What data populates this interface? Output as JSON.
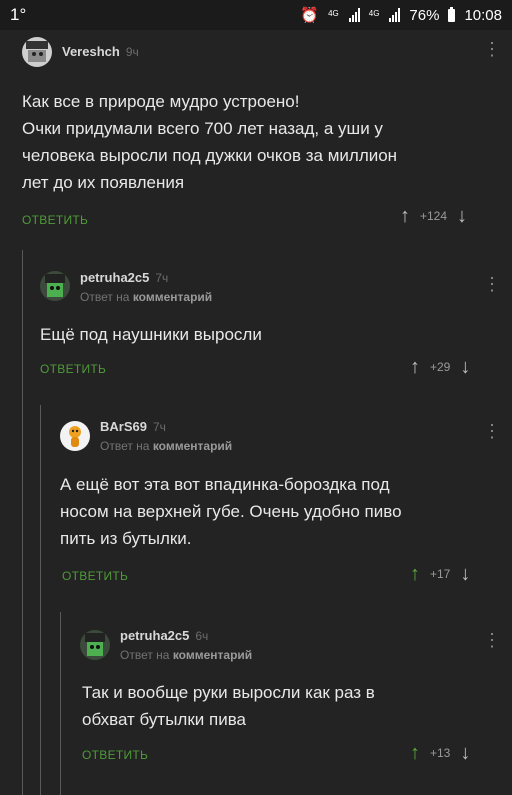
{
  "status": {
    "left": "1°",
    "net1": "4G",
    "net2": "4G",
    "battery_pct": "76%",
    "time": "10:08"
  },
  "comments": [
    {
      "author": "Vereshch",
      "time": "9ч",
      "body": [
        "Как все в природе мудро устроено!",
        "Очки придумали всего 700 лет назад, а уши у",
        "человека выросли под дужки очков за миллион",
        "лет до их появления"
      ],
      "reply": "ОТВЕТИТЬ",
      "score": "+124"
    },
    {
      "author": "petruha2c5",
      "time": "7ч",
      "sub_prefix": "Ответ на",
      "sub_link": "комментарий",
      "body": [
        "Ещё под наушники выросли"
      ],
      "reply": "ОТВЕТИТЬ",
      "score": "+29"
    },
    {
      "author": "BArS69",
      "time": "7ч",
      "sub_prefix": "Ответ на",
      "sub_link": "комментарий",
      "body": [
        "А ещё вот эта вот впадинка-бороздка под",
        "носом на верхней губе. Очень удобно пиво",
        "пить из бутылки."
      ],
      "reply": "ОТВЕТИТЬ",
      "score": "+17"
    },
    {
      "author": "petruha2c5",
      "time": "6ч",
      "sub_prefix": "Ответ на",
      "sub_link": "комментарий",
      "body": [
        "Так и вообще руки выросли как раз в",
        "обхват бутылки пива"
      ],
      "reply": "ОТВЕТИТЬ",
      "score": "+13"
    }
  ],
  "colors": {
    "background": "#232323",
    "reply_link": "#4f9a3a",
    "upvoted": "#5aa93a"
  },
  "icons": {
    "up": "↑",
    "down": "↓",
    "menu": "⋮"
  }
}
